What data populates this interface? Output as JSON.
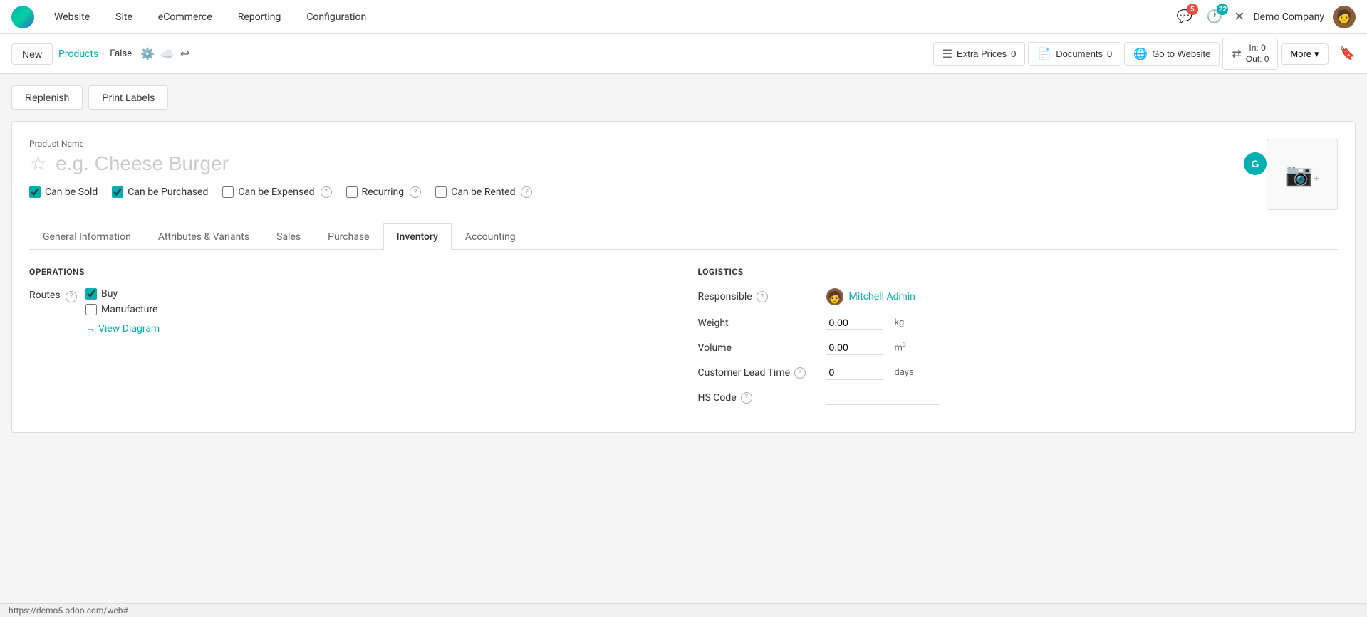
{
  "app": {
    "logo_alt": "Odoo Logo",
    "nav_items": [
      "Website",
      "Site",
      "eCommerce",
      "Reporting",
      "Configuration"
    ],
    "notifications_chat": "5",
    "notifications_clock": "22",
    "company_name": "Demo Company"
  },
  "toolbar": {
    "new_label": "New",
    "breadcrumb_link": "Products",
    "breadcrumb_status": "False",
    "extra_prices_label": "Extra Prices",
    "extra_prices_count": "0",
    "documents_label": "Documents",
    "documents_count": "0",
    "go_to_website_label": "Go to Website",
    "in_label": "In: 0",
    "out_label": "Out: 0",
    "more_label": "More"
  },
  "actions": {
    "replenish_label": "Replenish",
    "print_labels_label": "Print Labels"
  },
  "product": {
    "name_label": "Product Name",
    "name_placeholder": "e.g. Cheese Burger",
    "can_be_sold_label": "Can be Sold",
    "can_be_sold_checked": true,
    "can_be_purchased_label": "Can be Purchased",
    "can_be_purchased_checked": true,
    "can_be_expensed_label": "Can be Expensed",
    "can_be_expensed_checked": false,
    "recurring_label": "Recurring",
    "recurring_checked": false,
    "can_be_rented_label": "Can be Rented",
    "can_be_rented_checked": false
  },
  "tabs": [
    {
      "id": "general",
      "label": "General Information"
    },
    {
      "id": "attributes",
      "label": "Attributes & Variants"
    },
    {
      "id": "sales",
      "label": "Sales"
    },
    {
      "id": "purchase",
      "label": "Purchase"
    },
    {
      "id": "inventory",
      "label": "Inventory",
      "active": true
    },
    {
      "id": "accounting",
      "label": "Accounting"
    }
  ],
  "operations": {
    "section_title": "OPERATIONS",
    "routes_label": "Routes",
    "buy_label": "Buy",
    "buy_checked": true,
    "manufacture_label": "Manufacture",
    "manufacture_checked": false,
    "view_diagram_label": "View Diagram"
  },
  "logistics": {
    "section_title": "LOGISTICS",
    "responsible_label": "Responsible",
    "responsible_name": "Mitchell Admin",
    "weight_label": "Weight",
    "weight_value": "0.00",
    "weight_unit": "kg",
    "volume_label": "Volume",
    "volume_value": "0.00",
    "volume_unit": "m³",
    "customer_lead_time_label": "Customer Lead Time",
    "customer_lead_time_value": "0",
    "customer_lead_time_unit": "days",
    "hs_code_label": "HS Code"
  },
  "statusbar": {
    "url": "https://demo5.odoo.com/web#"
  }
}
